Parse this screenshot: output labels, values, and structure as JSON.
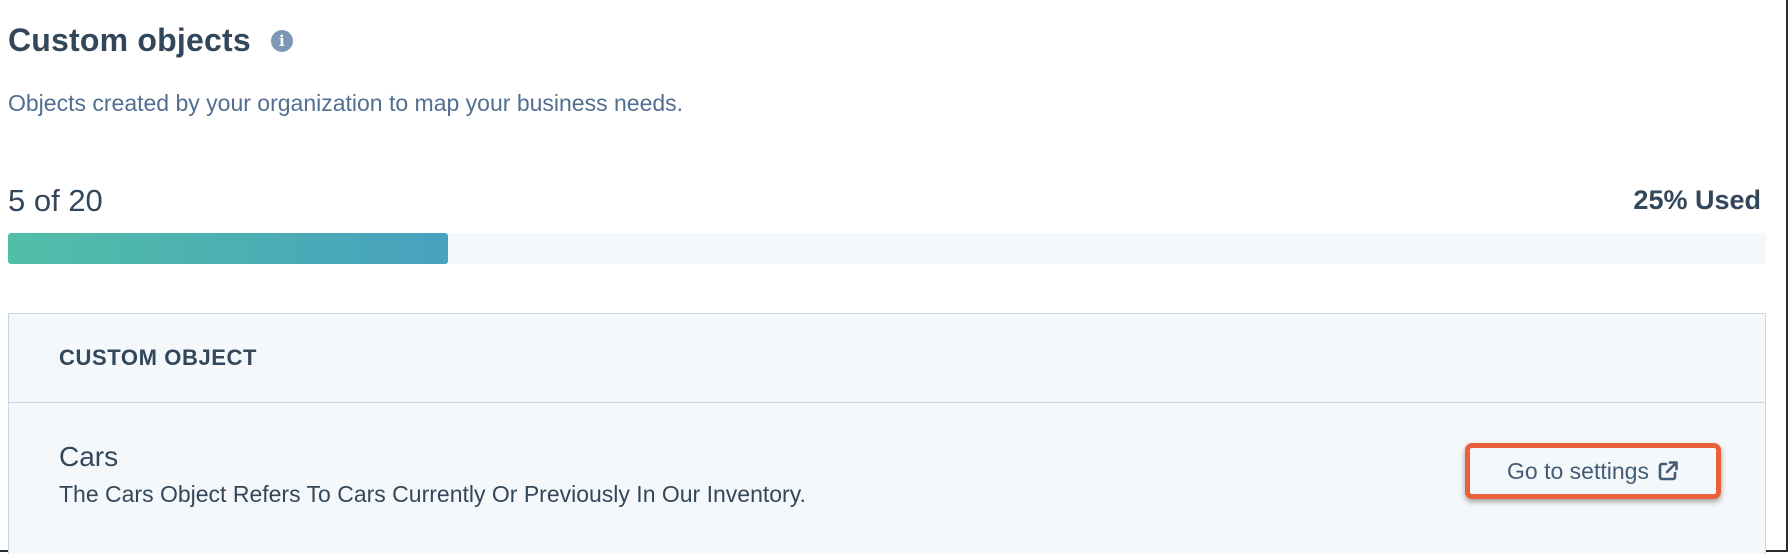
{
  "header": {
    "title": "Custom objects",
    "info_icon": "info-circle-icon",
    "description": "Objects created by your organization to map your business needs."
  },
  "usage": {
    "count_text": "5 of 20",
    "percent_text": "25% Used",
    "used": 5,
    "limit": 20,
    "fill_fraction": 0.25,
    "bar_color_start": "#51bfa7",
    "bar_color_end": "#47a1bf"
  },
  "table": {
    "column_header": "CUSTOM OBJECT",
    "rows": [
      {
        "name": "Cars",
        "description": "The Cars Object Refers To Cars Currently Or Previously In Our Inventory.",
        "action_label": "Go to settings",
        "action_icon": "external-link-icon"
      }
    ]
  },
  "colors": {
    "highlight": "#e8603c",
    "text_primary": "#33475b",
    "text_secondary": "#516f90"
  }
}
